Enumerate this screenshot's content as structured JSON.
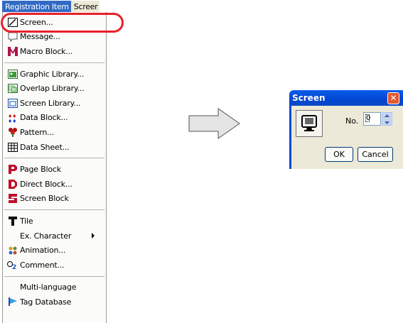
{
  "menubar": {
    "active_label": "Registration Item",
    "next_label": "Screer"
  },
  "menu": {
    "groups": [
      [
        {
          "label": "Screen...",
          "icon": "screen-icon"
        },
        {
          "label": "Message...",
          "icon": "message-icon"
        },
        {
          "label": "Macro Block...",
          "icon": "macro-block-icon"
        }
      ],
      [
        {
          "label": "Graphic Library...",
          "icon": "graphic-library-icon"
        },
        {
          "label": "Overlap Library...",
          "icon": "overlap-library-icon"
        },
        {
          "label": "Screen Library...",
          "icon": "screen-library-icon"
        },
        {
          "label": "Data Block...",
          "icon": "data-block-icon"
        },
        {
          "label": "Pattern...",
          "icon": "pattern-icon"
        },
        {
          "label": "Data Sheet...",
          "icon": "data-sheet-icon"
        }
      ],
      [
        {
          "label": "Page Block",
          "icon": "page-block-icon"
        },
        {
          "label": "Direct Block...",
          "icon": "direct-block-icon"
        },
        {
          "label": "Screen Block",
          "icon": "screen-block-icon"
        }
      ],
      [
        {
          "label": "Tile",
          "icon": "tile-icon"
        },
        {
          "label": "Ex. Character",
          "icon": "",
          "submenu": true
        },
        {
          "label": "Animation...",
          "icon": "animation-icon"
        },
        {
          "label": "Comment...",
          "icon": "comment-icon"
        }
      ],
      [
        {
          "label": "Multi-language",
          "icon": ""
        },
        {
          "label": "Tag Database",
          "icon": "tag-database-icon"
        }
      ]
    ]
  },
  "dialog": {
    "title": "Screen",
    "no_label": "No.",
    "no_value": "0",
    "ok_label": "OK",
    "cancel_label": "Cancel"
  },
  "colors": {
    "highlight_ring": "#e8202a",
    "menubar_active": "#316ac5",
    "dialog_title": "#0346d4"
  }
}
